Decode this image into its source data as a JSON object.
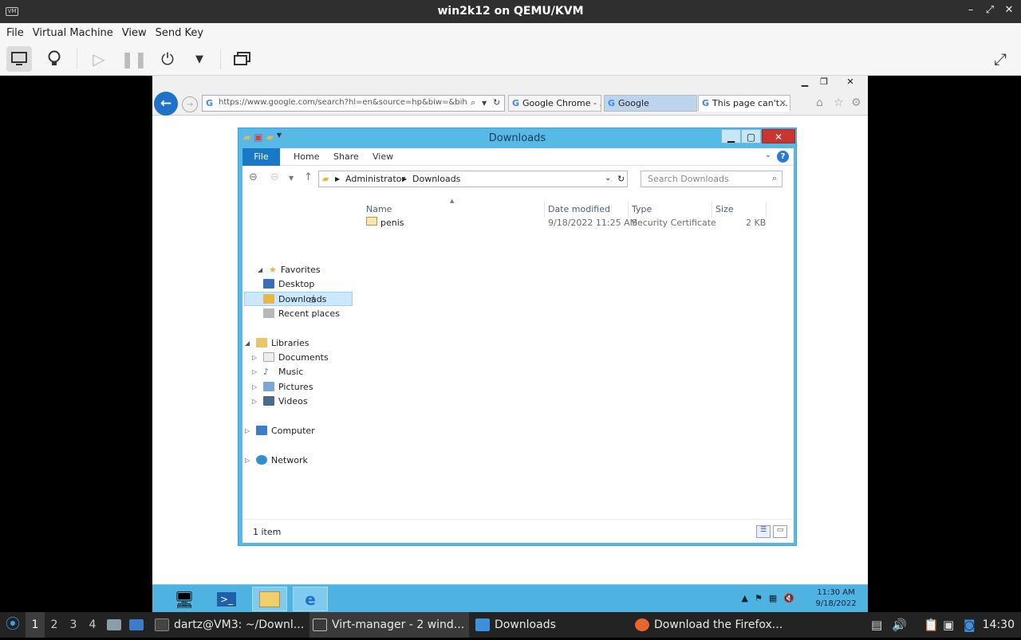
{
  "window": {
    "title": "win2k12 on QEMU/KVM",
    "app_icon_label": "VM"
  },
  "menubar": [
    "File",
    "Virtual Machine",
    "View",
    "Send Key"
  ],
  "guest": {
    "ie": {
      "url": "https://www.google.com/search?hl=en&source=hp&biw=&bih=&",
      "tabs": [
        {
          "label": "Google Chrome - ..."
        },
        {
          "label": "Google"
        },
        {
          "label": "This page can't..."
        }
      ]
    },
    "explorer": {
      "title": "Downloads",
      "ribbon_tabs": [
        "File",
        "Home",
        "Share",
        "View"
      ],
      "breadcrumb": [
        "Administrator",
        "Downloads"
      ],
      "search_placeholder": "Search Downloads",
      "nav": {
        "favorites": {
          "label": "Favorites",
          "items": [
            "Desktop",
            "Downloads",
            "Recent places"
          ]
        },
        "libraries": {
          "label": "Libraries",
          "items": [
            "Documents",
            "Music",
            "Pictures",
            "Videos"
          ]
        },
        "computer": "Computer",
        "network": "Network"
      },
      "columns": [
        "Name",
        "Date modified",
        "Type",
        "Size"
      ],
      "files": [
        {
          "name": "penis",
          "date": "9/18/2022 11:25 AM",
          "type": "Security Certificate",
          "size": "2 KB"
        }
      ],
      "status": "1 item"
    },
    "taskbar": {
      "clock_time": "11:30 AM",
      "clock_date": "9/18/2022"
    }
  },
  "host_taskbar": {
    "workspaces": [
      "1",
      "2",
      "3",
      "4"
    ],
    "tasks": [
      {
        "label": "dartz@VM3: ~/Downl..."
      },
      {
        "label": "Virt-manager - 2 wind..."
      },
      {
        "label": "Downloads"
      },
      {
        "label": "Download the Firefox..."
      }
    ],
    "clock": "14:30"
  },
  "colors": {
    "explorer_frame": "#57b9e6",
    "guest_taskbar": "#4fb3e2",
    "ie_back": "#1e73c8",
    "close_red": "#c7372f"
  }
}
